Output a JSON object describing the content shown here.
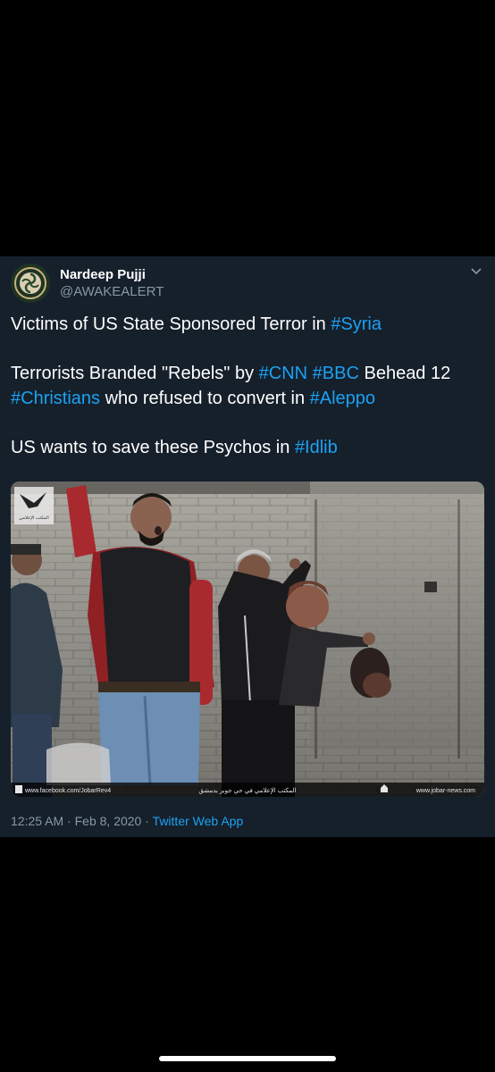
{
  "author": {
    "name": "Nardeep Pujji",
    "handle": "@AWAKEALERT"
  },
  "tweet": {
    "line1_text": "Victims of US State Sponsored Terror in ",
    "line1_tag": "#Syria",
    "line2_text_a": "Terrorists Branded \"Rebels\" by ",
    "line2_tag_cnn": "#CNN",
    "line2_tag_bbc": "#BBC",
    "line2_text_b": " Behead 12 ",
    "line2_tag_christians": "#Christians",
    "line2_text_c": " who refused to convert in ",
    "line2_tag_aleppo": "#Aleppo",
    "line3_text": "US wants to save these Psychos in ",
    "line3_tag": "#Idlib"
  },
  "media": {
    "watermark_left": "www.facebook.com/JobarRev4",
    "watermark_center": "المكتب الإعلامي في حي جوبر بدمشق",
    "watermark_right": "www.jobar-news.com",
    "logo_text": "المكتب الإعلامي في حي جوبر"
  },
  "meta": {
    "time": "12:25 AM",
    "separator": " · ",
    "date": "Feb 8, 2020",
    "app": "Twitter Web App"
  },
  "colors": {
    "background": "#000000",
    "card": "#15202b",
    "link": "#1da1f2",
    "secondary_text": "#8899a6"
  },
  "icons": [
    "avatar-logo-icon",
    "chevron-down-icon",
    "home-icon"
  ]
}
